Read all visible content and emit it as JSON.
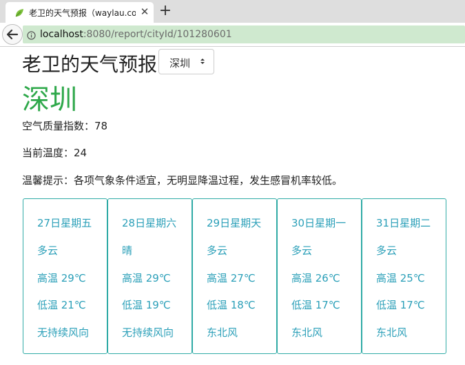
{
  "browser": {
    "tab_title": "老卫的天气预报（waylau.co",
    "tab_close": "✕",
    "new_tab": "+",
    "url_host": "localhost",
    "url_rest": ":8080/report/cityId/101280601"
  },
  "page": {
    "heading": "老卫的天气预报",
    "city_select_value": "深圳",
    "city_name": "深圳",
    "aqi_text": "空气质量指数：78",
    "temp_text": "当前温度：24",
    "tip_text": "温馨提示：各项气象条件适宜，无明显降温过程，发生感冒机率较低。"
  },
  "forecast": [
    {
      "date": "27日星期五",
      "weather": "多云",
      "high": "高温 29℃",
      "low": "低温 21℃",
      "wind": "无持续风向"
    },
    {
      "date": "28日星期六",
      "weather": "晴",
      "high": "高温 29℃",
      "low": "低温 19℃",
      "wind": "无持续风向"
    },
    {
      "date": "29日星期天",
      "weather": "多云",
      "high": "高温 27℃",
      "low": "低温 18℃",
      "wind": "东北风"
    },
    {
      "date": "30日星期一",
      "weather": "多云",
      "high": "高温 26℃",
      "low": "低温 17℃",
      "wind": "东北风"
    },
    {
      "date": "31日星期二",
      "weather": "多云",
      "high": "高温 25℃",
      "low": "低温 17℃",
      "wind": "东北风"
    }
  ],
  "colors": {
    "city_green": "#2ea84a",
    "card_text": "#2a9fb8",
    "card_border": "#2eaaa5",
    "urlbar_bg": "#cfe9cf"
  },
  "icons": {
    "favicon": "leaf-icon",
    "back": "back-arrow-icon",
    "info": "info-icon",
    "select_arrow": "select-arrows-icon"
  }
}
